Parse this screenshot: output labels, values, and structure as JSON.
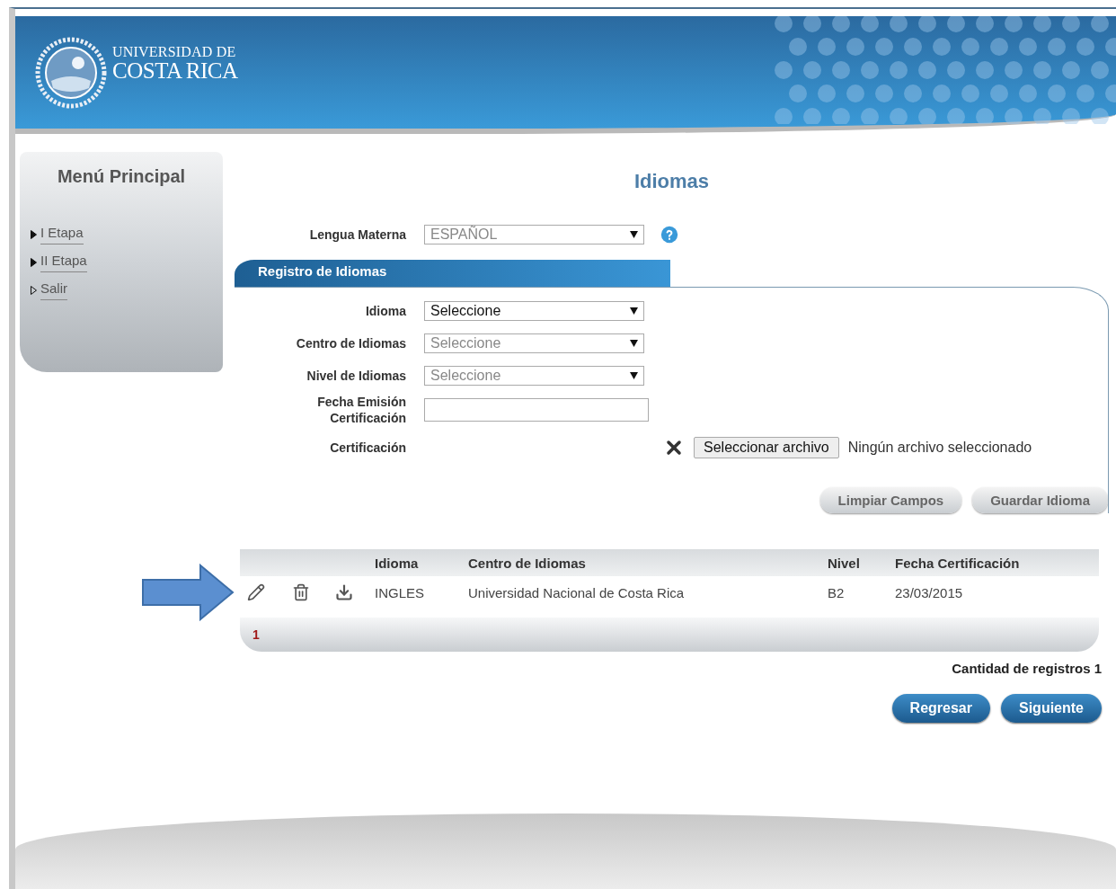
{
  "header": {
    "logo_line_1": "UNIVERSIDAD DE",
    "logo_line_2": "COSTA RICA"
  },
  "sidebar": {
    "title": "Menú Principal",
    "items": [
      {
        "label": "I Etapa",
        "kind": "submenu"
      },
      {
        "label": "II Etapa",
        "kind": "submenu"
      },
      {
        "label": "Salir",
        "kind": "link"
      }
    ]
  },
  "page_title": "Idiomas",
  "mother_tongue": {
    "label": "Lengua Materna",
    "value": "ESPAÑOL",
    "disabled": true
  },
  "section": {
    "title": "Registro de Idiomas"
  },
  "fields": [
    {
      "kind": "select",
      "label": "Idioma",
      "value": "Seleccione",
      "disabled": false
    },
    {
      "kind": "select",
      "label": "Centro de Idiomas",
      "value": "Seleccione",
      "disabled": true
    },
    {
      "kind": "select",
      "label": "Nivel de Idiomas",
      "value": "Seleccione",
      "disabled": true
    },
    {
      "kind": "text",
      "label": "Fecha Emisión Certificación"
    },
    {
      "kind": "file",
      "label": "Certificación",
      "button": "Seleccionar archivo",
      "status": "Ningún archivo seleccionado"
    }
  ],
  "form_buttons": [
    "Limpiar Campos",
    "Guardar Idioma"
  ],
  "table": {
    "columns": [
      "Idioma",
      "Centro de Idiomas",
      "Nivel",
      "Fecha Certificación"
    ],
    "rows": [
      {
        "cells": [
          "INGLES",
          "Universidad Nacional de Costa Rica",
          "B2",
          "23/03/2015"
        ]
      }
    ],
    "pages": [
      {
        "label": "1",
        "selected": true
      }
    ]
  },
  "record_count": "Cantidad de registros 1",
  "nav_buttons": [
    "Regresar",
    "Siguiente"
  ]
}
